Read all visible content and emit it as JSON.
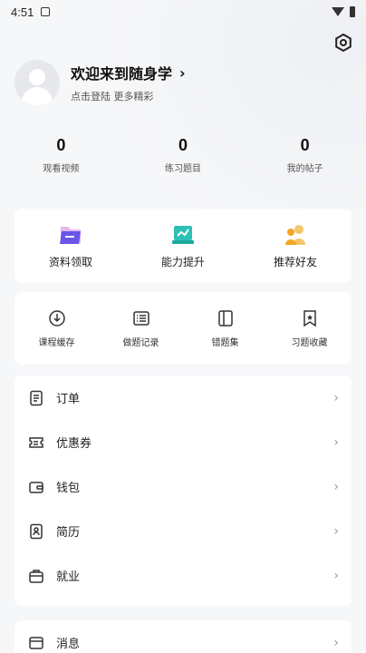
{
  "status_bar": {
    "time": "4:51"
  },
  "profile": {
    "title": "欢迎来到随身学",
    "subtitle": "点击登陆 更多精彩"
  },
  "stats": [
    {
      "value": "0",
      "label": "观看视频"
    },
    {
      "value": "0",
      "label": "练习题目"
    },
    {
      "value": "0",
      "label": "我的帖子"
    }
  ],
  "features": [
    {
      "label": "资料领取",
      "icon": "folder-icon",
      "color": "#6a55e8"
    },
    {
      "label": "能力提升",
      "icon": "chart-icon",
      "color": "#2fc0b4"
    },
    {
      "label": "推荐好友",
      "icon": "friends-icon",
      "color": "#f5b53b"
    }
  ],
  "tools": [
    {
      "label": "课程缓存",
      "icon": "download-icon"
    },
    {
      "label": "做题记录",
      "icon": "record-icon"
    },
    {
      "label": "错题集",
      "icon": "book-icon"
    },
    {
      "label": "习题收藏",
      "icon": "bookmark-icon"
    }
  ],
  "menu": [
    {
      "label": "订单",
      "icon": "order-icon"
    },
    {
      "label": "优惠券",
      "icon": "coupon-icon"
    },
    {
      "label": "钱包",
      "icon": "wallet-icon"
    },
    {
      "label": "简历",
      "icon": "resume-icon"
    },
    {
      "label": "就业",
      "icon": "job-icon"
    }
  ],
  "message": {
    "label": "消息",
    "icon": "message-icon"
  }
}
